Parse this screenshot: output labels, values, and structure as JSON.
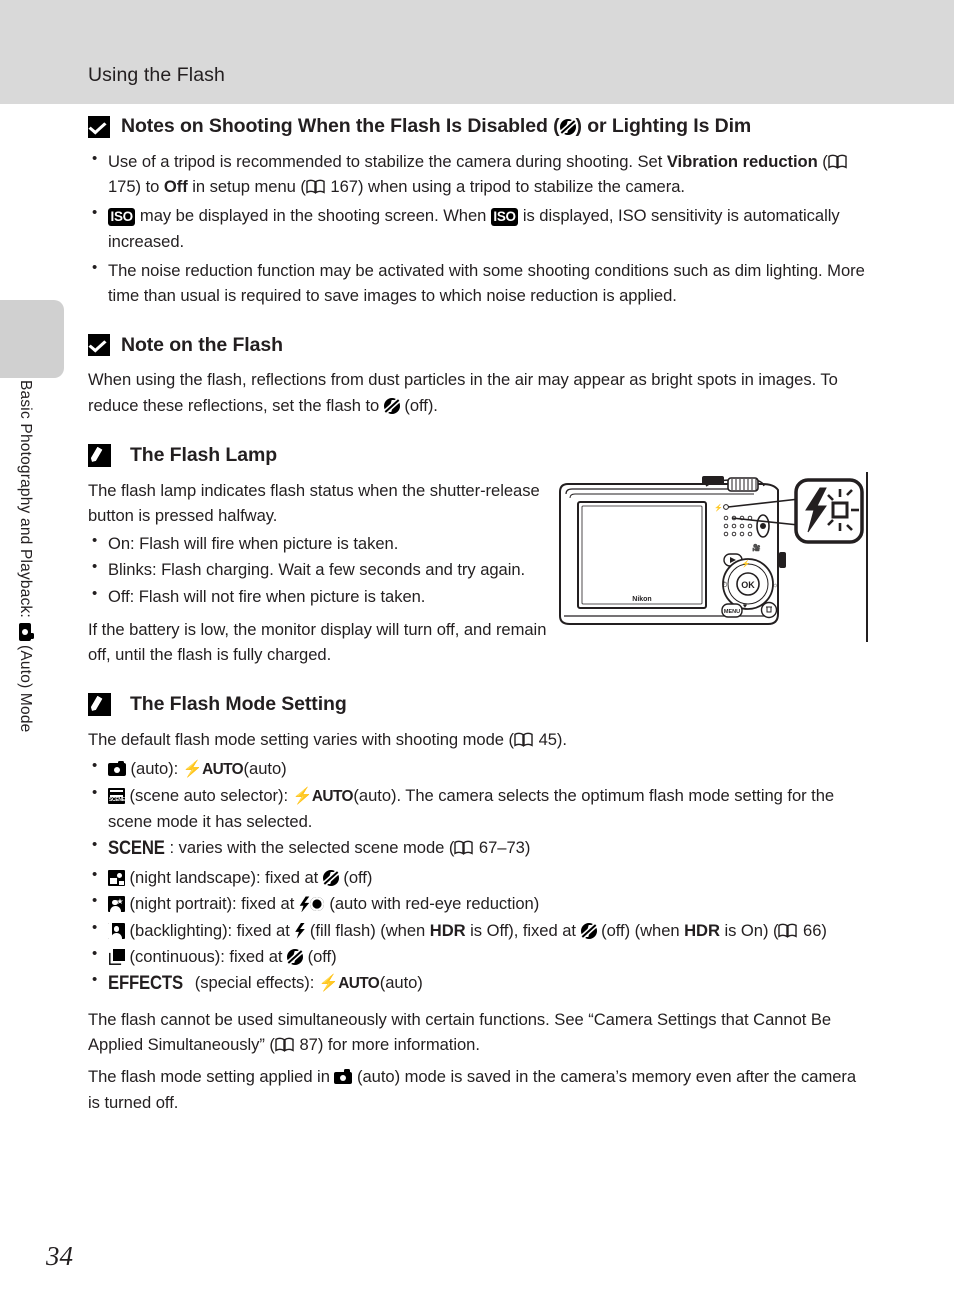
{
  "header": {
    "title": "Using the Flash"
  },
  "chapter_tab": {
    "label_before_icon": "Basic Photography and Playback:",
    "icon": "camera-auto-icon",
    "label_after_icon": "(Auto) Mode"
  },
  "page": {
    "number": "34"
  },
  "notes": [
    {
      "id": "flash-disabled",
      "icon": "caution-check-icon",
      "heading_part1": "Notes on Shooting When the Flash Is Disabled (",
      "heading_icon": "flash-off-icon",
      "heading_part2": ") or Lighting Is Dim",
      "bullets": [
        {
          "segments": [
            {
              "t": "Use of a tripod is recommended to stabilize the camera during shooting. Set "
            },
            {
              "t": "Vibration reduction",
              "bold": true
            },
            {
              "t": " ("
            },
            {
              "icon": "book-icon"
            },
            {
              "t": " 175) to "
            },
            {
              "t": "Off",
              "bold": true
            },
            {
              "t": " in setup menu ("
            },
            {
              "icon": "book-icon"
            },
            {
              "t": " 167) when using a tripod to stabilize the camera."
            }
          ]
        },
        {
          "segments": [
            {
              "icon": "iso-badge-icon",
              "text": "ISO"
            },
            {
              "t": " may be displayed in the shooting screen. When "
            },
            {
              "icon": "iso-badge-icon",
              "text": "ISO"
            },
            {
              "t": " is displayed, ISO sensitivity is automatically increased."
            }
          ]
        },
        {
          "segments": [
            {
              "t": "The noise reduction function may be activated with some shooting conditions such as dim lighting. More time than usual is required to save images to which noise reduction is applied."
            }
          ]
        }
      ]
    },
    {
      "id": "note-on-flash",
      "icon": "caution-check-icon",
      "heading": "Note on the Flash",
      "paragraph_part1": "When using the flash, reflections from dust particles in the air may appear as bright spots in images. To reduce these reflections, set the flash to ",
      "paragraph_icon": "flash-off-icon",
      "paragraph_part2": " (off)."
    },
    {
      "id": "flash-lamp",
      "icon": "tip-pencil-icon",
      "heading": "The Flash Lamp",
      "intro": "The flash lamp indicates flash status when the shutter-release button is pressed halfway.",
      "bullets": [
        "On: Flash will fire when picture is taken.",
        "Blinks: Flash charging. Wait a few seconds and try again.",
        "Off: Flash will not fire when picture is taken."
      ],
      "outro": "If the battery is low, the monitor display will turn off, and remain off, until the flash is fully charged.",
      "figure": {
        "name": "camera-rear-illustration",
        "brand_text": "Nikon",
        "callout": "flash-lamp-blinking-callout"
      }
    },
    {
      "id": "flash-mode-setting",
      "icon": "tip-pencil-icon",
      "heading": "The Flash Mode Setting",
      "intro_part1": "The default flash mode setting varies with shooting mode (",
      "intro_icon": "book-icon",
      "intro_part2": " 45).",
      "bullets": [
        {
          "segments": [
            {
              "icon": "camera-auto-icon"
            },
            {
              "t": " (auto): "
            },
            {
              "icon": "flash-auto-icon",
              "text": "AUTO"
            },
            {
              "t": " (auto)"
            }
          ]
        },
        {
          "segments": [
            {
              "icon": "scene-auto-selector-icon"
            },
            {
              "t": " (scene auto selector): "
            },
            {
              "icon": "flash-auto-icon",
              "text": "AUTO"
            },
            {
              "t": " (auto). The camera selects the optimum flash mode setting for the scene mode it has selected."
            }
          ]
        },
        {
          "segments": [
            {
              "word": "SCENE"
            },
            {
              "t": ": varies with the selected scene mode ("
            },
            {
              "icon": "book-icon"
            },
            {
              "t": " 67–73)"
            }
          ]
        },
        {
          "segments": [
            {
              "icon": "night-landscape-icon"
            },
            {
              "t": " (night landscape): fixed at "
            },
            {
              "icon": "flash-off-icon"
            },
            {
              "t": " (off)"
            }
          ]
        },
        {
          "segments": [
            {
              "icon": "night-portrait-icon"
            },
            {
              "t": " (night portrait): fixed at "
            },
            {
              "icon": "red-eye-reduction-icon"
            },
            {
              "t": " (auto with red-eye reduction)"
            }
          ]
        },
        {
          "segments": [
            {
              "icon": "backlighting-icon"
            },
            {
              "t": " (backlighting): fixed at "
            },
            {
              "icon": "fill-flash-icon"
            },
            {
              "t": " (fill flash) (when "
            },
            {
              "t": "HDR",
              "bold": true
            },
            {
              "t": " is Off), fixed at "
            },
            {
              "icon": "flash-off-icon"
            },
            {
              "t": " (off) (when "
            },
            {
              "t": "HDR",
              "bold": true
            },
            {
              "t": " is On) ("
            },
            {
              "icon": "book-icon"
            },
            {
              "t": " 66)"
            }
          ]
        },
        {
          "segments": [
            {
              "icon": "continuous-icon"
            },
            {
              "t": " (continuous): fixed at "
            },
            {
              "icon": "flash-off-icon"
            },
            {
              "t": " (off)"
            }
          ]
        },
        {
          "segments": [
            {
              "word": "EFFECTS"
            },
            {
              "t": " (special effects): "
            },
            {
              "icon": "flash-auto-icon",
              "text": "AUTO"
            },
            {
              "t": " (auto)"
            }
          ]
        }
      ],
      "closing": [
        {
          "segments": [
            {
              "t": "The flash cannot be used simultaneously with certain functions. See “Camera Settings that Cannot Be Applied Simultaneously” ("
            },
            {
              "icon": "book-icon"
            },
            {
              "t": " 87) for more information."
            }
          ]
        },
        {
          "segments": [
            {
              "t": "The flash mode setting applied in "
            },
            {
              "icon": "camera-auto-icon"
            },
            {
              "t": " (auto) mode is saved in the camera’s memory even after the camera is turned off."
            }
          ]
        }
      ]
    }
  ],
  "colors": {
    "header_band": "#d9d9d9",
    "chapter_tab": "#d0d0d0",
    "text": "#231f20"
  }
}
